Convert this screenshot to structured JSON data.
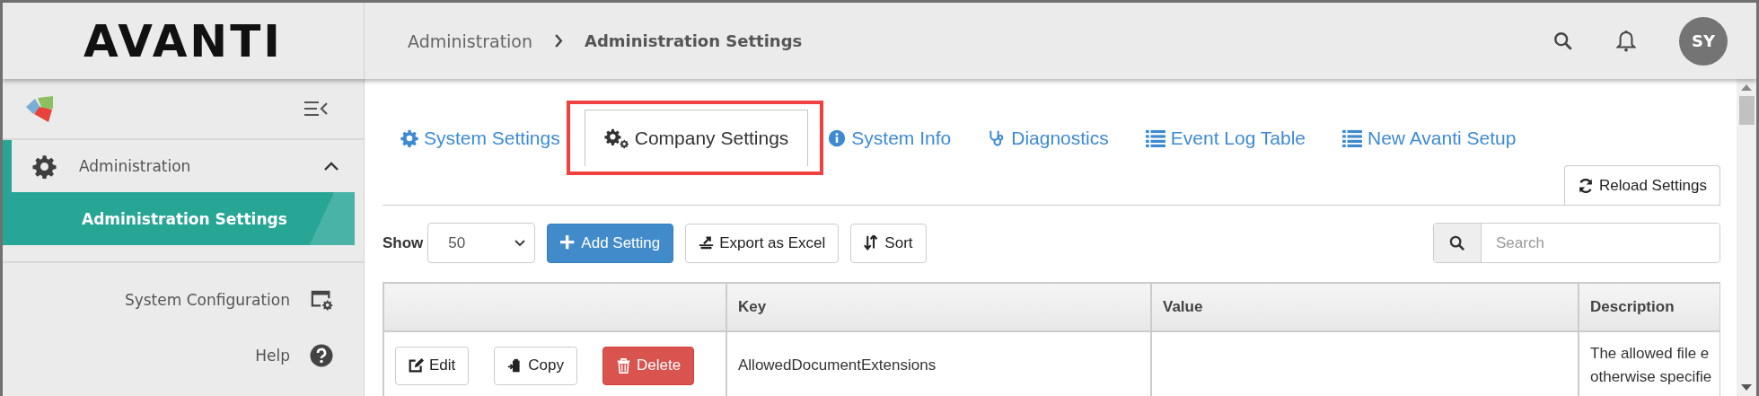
{
  "header": {
    "logo": "AVANTI",
    "breadcrumb": [
      "Administration",
      "Administration Settings"
    ],
    "avatar": "SY"
  },
  "sidebar": {
    "items": [
      {
        "label": "Administration",
        "kind": "group",
        "expanded": true,
        "selected": true,
        "children": [
          {
            "label": "Administration Settings",
            "selected": true
          }
        ]
      },
      {
        "label": "System Configuration",
        "kind": "config",
        "selected": false
      },
      {
        "label": "Help",
        "kind": "help",
        "selected": false
      }
    ]
  },
  "tabs": [
    {
      "label": "System Settings",
      "kind": "gear",
      "selected": false,
      "highlighted": false
    },
    {
      "label": "Company Settings",
      "kind": "gears",
      "selected": true,
      "highlighted": true
    },
    {
      "label": "System Info",
      "kind": "info",
      "selected": false,
      "highlighted": false
    },
    {
      "label": "Diagnostics",
      "kind": "stethoscope",
      "selected": false,
      "highlighted": false
    },
    {
      "label": "Event Log Table",
      "kind": "list",
      "selected": false,
      "highlighted": false
    },
    {
      "label": "New Avanti Setup",
      "kind": "list",
      "selected": false,
      "highlighted": false
    }
  ],
  "reload_button": "Reload Settings",
  "toolbar": {
    "show_label": "Show",
    "page_size": "50",
    "buttons": [
      {
        "label": "Add Setting",
        "kind": "add"
      },
      {
        "label": "Export as Excel",
        "kind": "export"
      },
      {
        "label": "Sort",
        "kind": "sort"
      }
    ],
    "search": {
      "placeholder": "Search"
    }
  },
  "table": {
    "columns": [
      "Key",
      "Value",
      "Description"
    ],
    "rows": [
      {
        "actions": [
          {
            "label": "Edit",
            "kind": "edit"
          },
          {
            "label": "Copy",
            "kind": "copy"
          },
          {
            "label": "Delete",
            "kind": "delete"
          }
        ],
        "key": "AllowedDocumentExtensions",
        "description": [
          "The allowed file e",
          "otherwise specifie"
        ]
      }
    ]
  }
}
